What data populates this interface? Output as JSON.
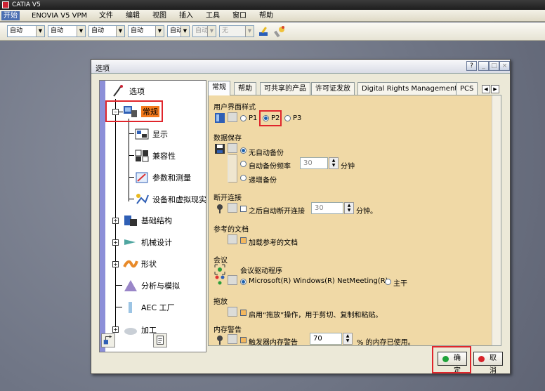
{
  "app": {
    "title": "CATIA V5"
  },
  "menubar": {
    "items": [
      "开始",
      "ENOVIA V5 VPM",
      "文件",
      "编辑",
      "视图",
      "插入",
      "工具",
      "窗口",
      "帮助"
    ]
  },
  "toolbar": {
    "combos": [
      "自动",
      "自动",
      "自动",
      "自动",
      "自动",
      "自动",
      "无"
    ]
  },
  "dialog": {
    "title": "选项",
    "help_btn": "?",
    "min_btn": "_",
    "max_btn": "□",
    "close_btn": "×",
    "tree": {
      "root": "选项",
      "items": [
        "常规",
        "显示",
        "兼容性",
        "参数和测量",
        "设备和虚拟现实",
        "基础结构",
        "机械设计",
        "形状",
        "分析与模拟",
        "AEC 工厂",
        "加工"
      ],
      "selected": "常规"
    },
    "tabs": [
      "常规",
      "帮助",
      "可共享的产品",
      "许可证发放",
      "Digital Rights Management",
      "PCS"
    ],
    "active_tab": "常规",
    "ui_style": {
      "title": "用户界面样式",
      "options": [
        "P1",
        "P2",
        "P3"
      ],
      "selected": "P2"
    },
    "data_save": {
      "title": "数据保存",
      "options": [
        "无自动备份",
        "自动备份频率",
        "递增备份"
      ],
      "selected": "无自动备份",
      "frequency_value": "30",
      "frequency_unit": "分钟"
    },
    "disconnect": {
      "title": "断开连接",
      "checkbox_label": "之后自动断开连接",
      "value": "30",
      "unit": "分钟。",
      "checked": false
    },
    "referenced_docs": {
      "title": "参考的文档",
      "checkbox_label": "加载参考的文档",
      "checked": false
    },
    "conference": {
      "title": "会议",
      "driver_label": "会议驱动程序",
      "options": [
        "Microsoft(R) Windows(R) NetMeeting(R)",
        "主干"
      ],
      "selected": "Microsoft(R) Windows(R) NetMeeting(R)"
    },
    "drag_drop": {
      "title": "拖放",
      "checkbox_label": "启用“拖放”操作，用于剪切、复制和粘贴。",
      "checked": false
    },
    "memory_warning": {
      "title": "内存警告",
      "checkbox_label": "触发器内存警告",
      "value": "70",
      "unit": "% 的内存已使用。",
      "checked": false
    },
    "ok_label": "确定",
    "cancel_label": "取消"
  },
  "colors": {
    "highlight": "#f47a1b",
    "annotation_red": "#e0252b",
    "panel_bg": "#f0d9a6",
    "ok_dot": "#1fa33a",
    "cancel_dot": "#d8232a"
  }
}
